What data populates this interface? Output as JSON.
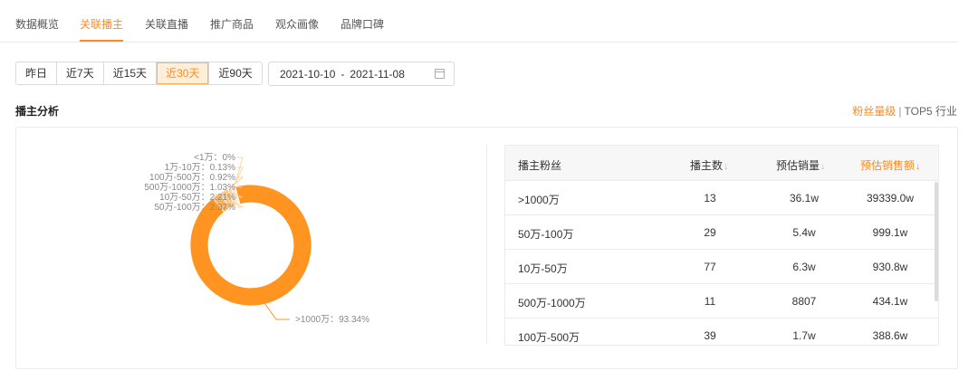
{
  "tabs": [
    {
      "label": "数据概览",
      "active": false
    },
    {
      "label": "关联播主",
      "active": true
    },
    {
      "label": "关联直播",
      "active": false
    },
    {
      "label": "推广商品",
      "active": false
    },
    {
      "label": "观众画像",
      "active": false
    },
    {
      "label": "品牌口碑",
      "active": false
    }
  ],
  "range_buttons": [
    "昨日",
    "近7天",
    "近15天",
    "近30天",
    "近90天"
  ],
  "range_active": "近30天",
  "date_range": {
    "start": "2021-10-10",
    "separator": "-",
    "end": "2021-11-08",
    "icon": "calendar-icon"
  },
  "section": {
    "title": "播主分析",
    "link_active": "粉丝量级",
    "link_sep": "|",
    "link_other": "TOP5 行业"
  },
  "colors": {
    "accent": "#ff8a1f",
    "donut_main": "#ff9420",
    "donut_light": "#ffcf99"
  },
  "chart_data": {
    "type": "pie",
    "style": "donut",
    "slices": [
      {
        "label": ">1000万",
        "value": 93.34,
        "display": ">1000万：93.34%"
      },
      {
        "label": "50万-100万",
        "value": 2.37,
        "display": "50万-100万：2.37%"
      },
      {
        "label": "10万-50万",
        "value": 2.21,
        "display": "10万-50万：2.21%"
      },
      {
        "label": "500万-1000万",
        "value": 1.03,
        "display": "500万-1000万：1.03%"
      },
      {
        "label": "100万-500万",
        "value": 0.92,
        "display": "100万-500万：0.92%"
      },
      {
        "label": "1万-10万",
        "value": 0.13,
        "display": "1万-10万：0.13%"
      },
      {
        "label": "<1万",
        "value": 0,
        "display": "<1万：0%"
      }
    ]
  },
  "table": {
    "headers": [
      "播主粉丝",
      "播主数",
      "预估销量",
      "预估销售额"
    ],
    "sort_arrow": "↓",
    "sorted_column": "预估销售额",
    "rows": [
      [
        ">1000万",
        "13",
        "36.1w",
        "39339.0w"
      ],
      [
        "50万-100万",
        "29",
        "5.4w",
        "999.1w"
      ],
      [
        "10万-50万",
        "77",
        "6.3w",
        "930.8w"
      ],
      [
        "500万-1000万",
        "11",
        "8807",
        "434.1w"
      ],
      [
        "100万-500万",
        "39",
        "1.7w",
        "388.6w"
      ]
    ]
  }
}
